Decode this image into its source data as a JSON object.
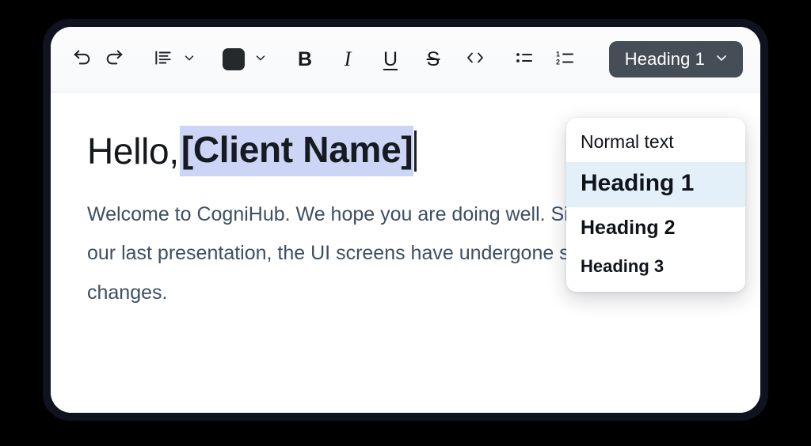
{
  "toolbar": {
    "buttons": [
      {
        "name": "undo-icon",
        "label": "Undo"
      },
      {
        "name": "redo-icon",
        "label": "Redo"
      },
      {
        "name": "text-align-icon",
        "label": "Text align"
      },
      {
        "name": "align-caret-icon",
        "label": "Align options"
      },
      {
        "name": "text-color-swatch",
        "label": "Text color"
      },
      {
        "name": "color-caret-icon",
        "label": "Color options"
      },
      {
        "name": "bold-icon",
        "label": "B"
      },
      {
        "name": "italic-icon",
        "label": "I"
      },
      {
        "name": "underline-icon",
        "label": "U"
      },
      {
        "name": "strikethrough-icon",
        "label": "S"
      },
      {
        "name": "code-brackets-icon",
        "label": "Code"
      },
      {
        "name": "bulleted-list-icon",
        "label": "Bulleted list"
      },
      {
        "name": "numbered-list-icon",
        "label": "Numbered list"
      }
    ],
    "style_dropdown": {
      "selected": "Heading 1",
      "caret_icon": "chevron-down-icon"
    }
  },
  "style_menu": {
    "items": [
      {
        "label": "Normal text",
        "selected": false
      },
      {
        "label": "Heading 1",
        "selected": true
      },
      {
        "label": "Heading 2",
        "selected": false
      },
      {
        "label": "Heading 3",
        "selected": false
      }
    ]
  },
  "document": {
    "heading_prefix": "Hello, ",
    "heading_selected_text": "[Client Name]",
    "body_paragraph": "Welcome to CogniHub. We hope you are doing well. Since our last presentation, the UI screens have undergone some changes."
  },
  "colors": {
    "accent_button_bg": "#454e56",
    "text_selection_bg": "#ccd5f6",
    "menu_selected_bg": "#e3f0fa",
    "body_text": "#3d4f63",
    "heading_text": "#14181d",
    "text_color_swatch": "#242a2b",
    "window_frame": "#10131f",
    "page_background": "#000000"
  }
}
